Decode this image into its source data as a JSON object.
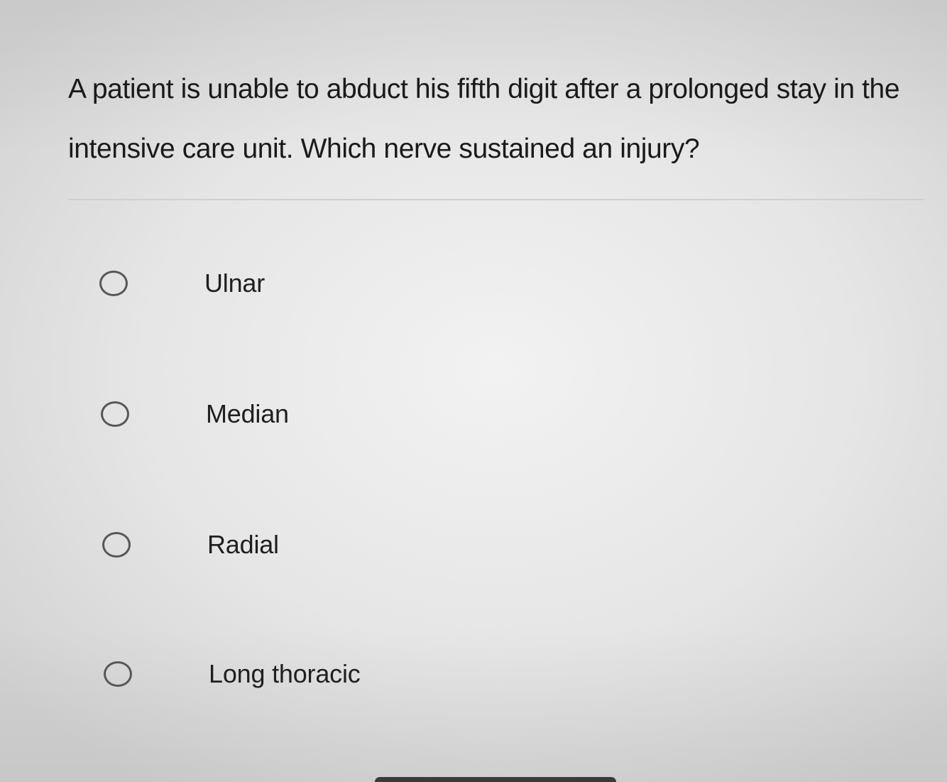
{
  "question": {
    "text": "A patient is unable to abduct his fifth digit after a prolonged stay in the intensive care unit. Which nerve sustained an injury?"
  },
  "options": [
    {
      "label": "Ulnar",
      "selected": false
    },
    {
      "label": "Median",
      "selected": false
    },
    {
      "label": "Radial",
      "selected": false
    },
    {
      "label": "Long thoracic",
      "selected": false
    }
  ],
  "colors": {
    "text": "#1a1a1a",
    "radio_border": "#575757",
    "divider": "#cfcfcf"
  }
}
